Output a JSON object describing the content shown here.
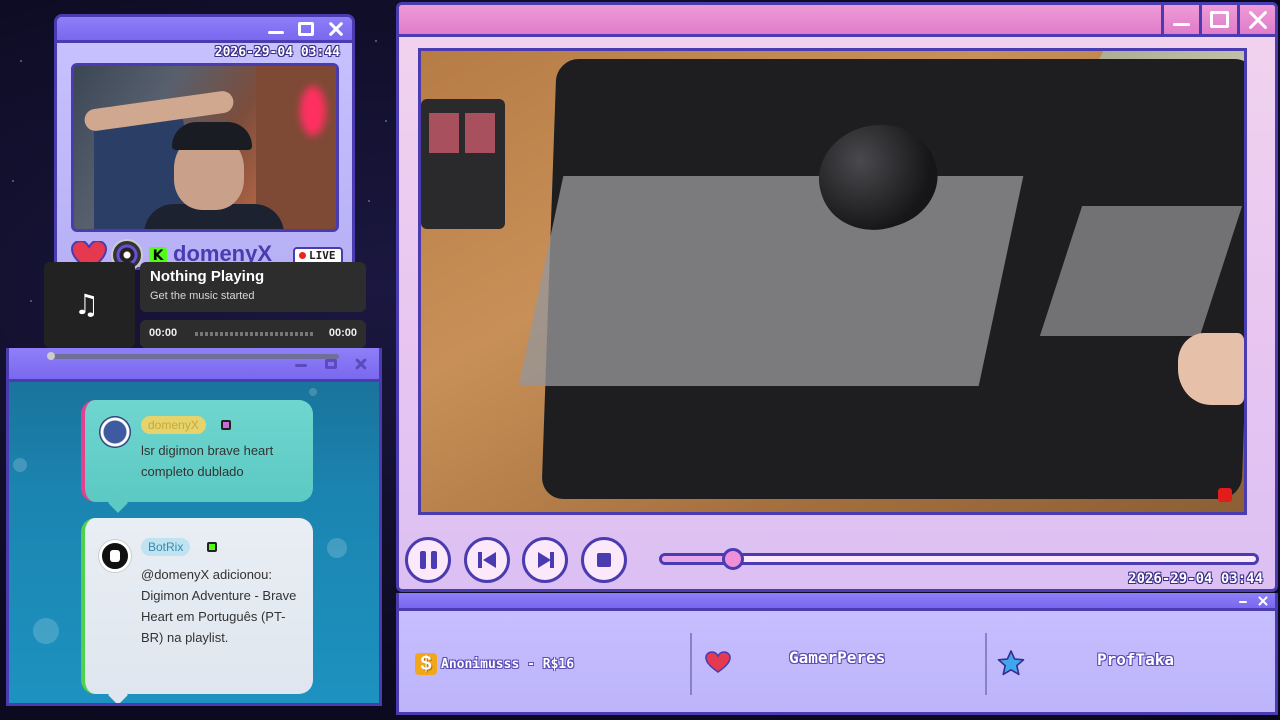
{
  "webcam": {
    "timestamp": "2026-29-04 03:44",
    "streamer": "domenyX",
    "live_label": "LIVE"
  },
  "music_player": {
    "title": "Nothing Playing",
    "subtitle": "Get the music started",
    "time_elapsed": "00:00",
    "time_total": "00:00",
    "icon": "music-note-icon"
  },
  "chat": {
    "messages": [
      {
        "username": "domenyX",
        "text": "lsr digimon brave heart completo dublado",
        "accent": "#e2418f"
      },
      {
        "username": "BotRix",
        "text": "@domenyX adicionou: Digimon Adventure - Brave Heart em Português (PT-BR) na playlist.",
        "accent": "#4fd14a"
      }
    ]
  },
  "player": {
    "timestamp": "2026-29-04 03:44",
    "progress_fraction": 0.12,
    "buttons": [
      "pause",
      "previous",
      "next",
      "stop"
    ]
  },
  "alerts": {
    "donation": "Anonimusss - R$16",
    "follower": "GamerPeres",
    "subscriber": "ProfTaka"
  },
  "colors": {
    "window_border": "#4b3bb0",
    "title_bar_purple": "#7a68ef",
    "title_bar_pink": "#e07ccb",
    "live_dot": "#e22222"
  }
}
